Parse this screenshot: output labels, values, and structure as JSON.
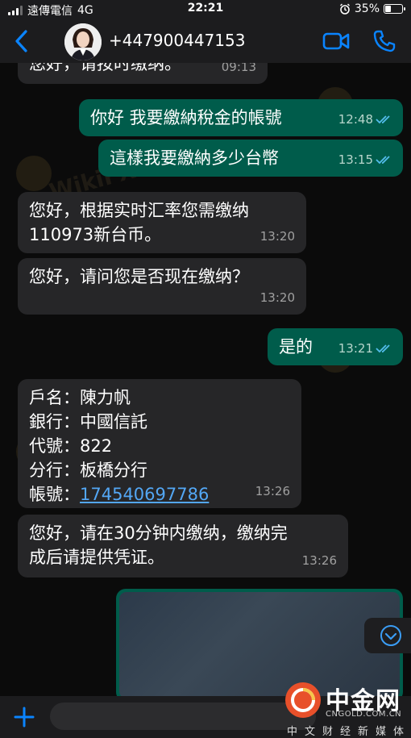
{
  "status_bar": {
    "carrier": "遠傳電信",
    "network": "4G",
    "time": "22:21",
    "battery": "35%",
    "battery_level": 0.35
  },
  "header": {
    "contact_name": "+447900447153",
    "back_icon": "chevron-left-icon",
    "video_icon": "video-camera-icon",
    "call_icon": "phone-icon"
  },
  "messages": [
    {
      "direction": "in",
      "text": "您好，请按时缴纳。",
      "time": "09:13"
    },
    {
      "direction": "out",
      "text": "你好  我要繳納稅金的帳號",
      "time": "12:48",
      "status": "read"
    },
    {
      "direction": "out",
      "text": "這樣我要繳納多少台幣",
      "time": "13:15",
      "status": "read"
    },
    {
      "direction": "in",
      "lines": [
        "您好，根据实时汇率您需缴纳",
        "110973新台币。"
      ],
      "time": "13:20"
    },
    {
      "direction": "in",
      "text": "您好，请问您是否现在缴纳？",
      "time": "13:20"
    },
    {
      "direction": "out",
      "text": "是的",
      "time": "13:21",
      "status": "read"
    },
    {
      "direction": "in",
      "lines": [
        "戶名：陳力帆",
        "銀行：中國信託",
        "代號：822",
        "分行：板橋分行"
      ],
      "account_label": "帳號：",
      "account_number": "174540697786",
      "time": "13:26"
    },
    {
      "direction": "in",
      "lines": [
        "您好，请在30分钟内缴纳，缴纳完",
        "成后请提供凭证。"
      ],
      "time": "13:26"
    }
  ],
  "watermark": "WikiFX",
  "colors": {
    "incoming_bubble": "#262628",
    "outgoing_bubble": "#005c4b",
    "link": "#53a7f5",
    "accent": "#0a84ff"
  },
  "branding": {
    "name": "中金网",
    "url": "CNGOLD.COM.CN",
    "tagline": "中文财经新媒体"
  }
}
